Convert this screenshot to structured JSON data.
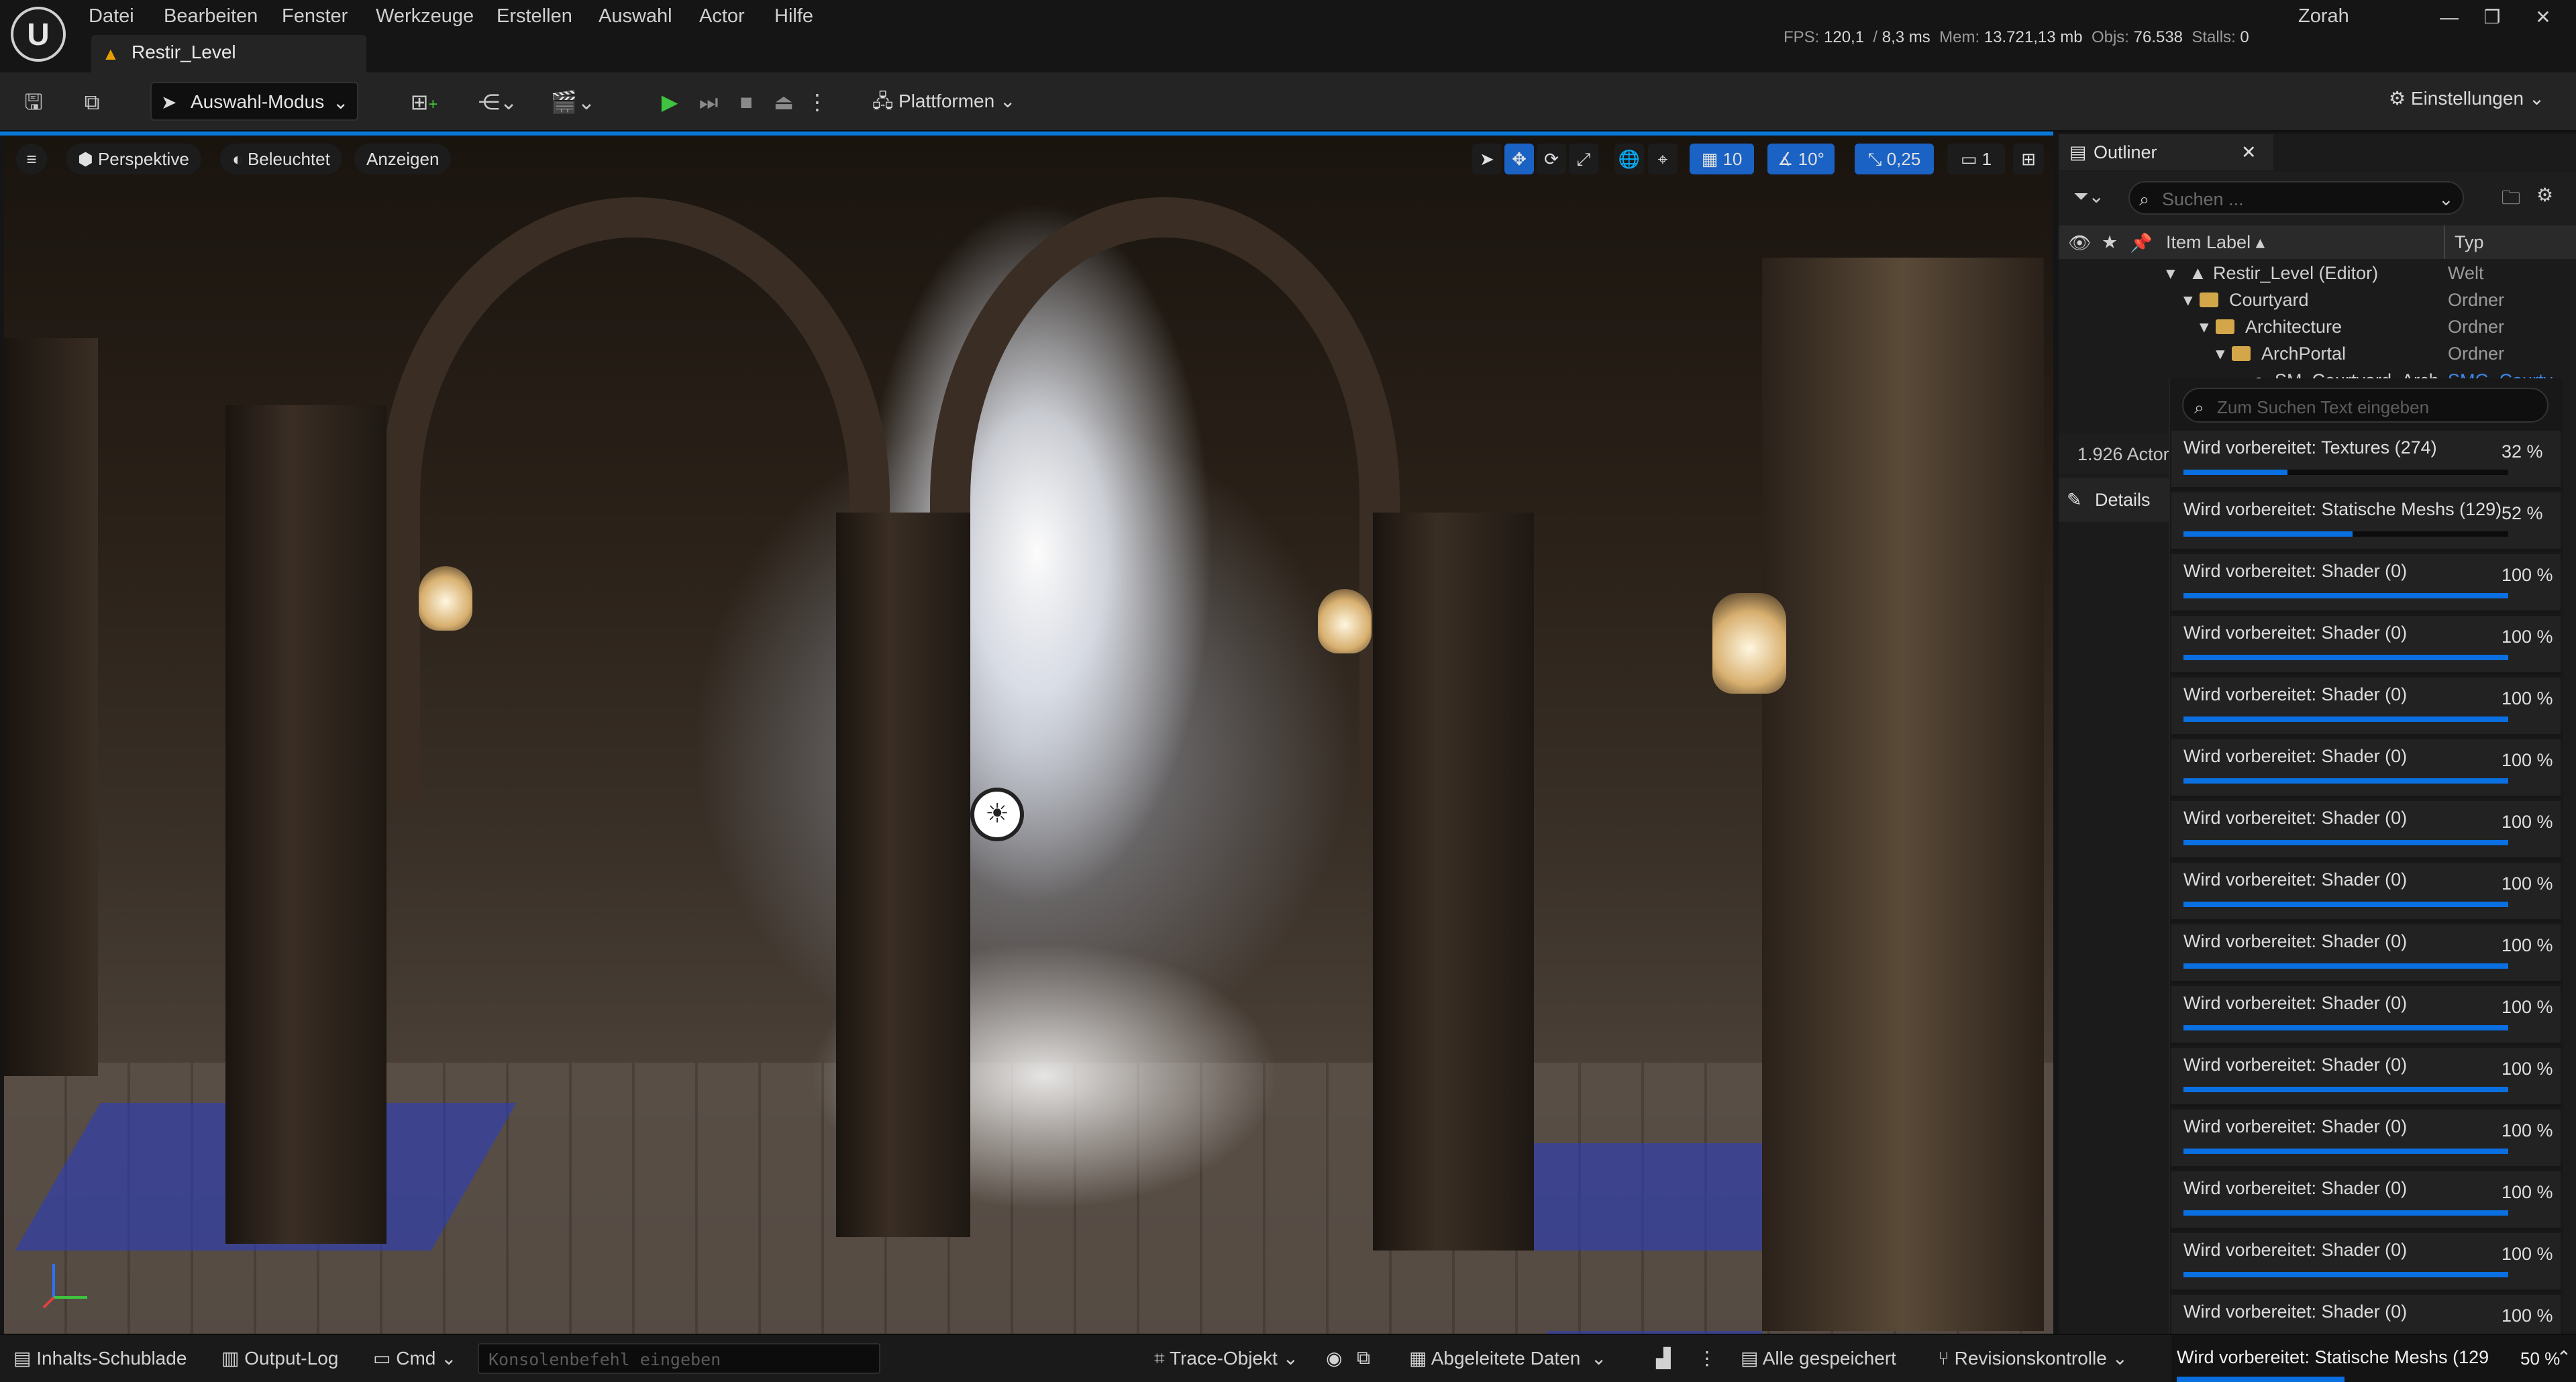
{
  "menu": [
    "Datei",
    "Bearbeiten",
    "Fenster",
    "Werkzeuge",
    "Erstellen",
    "Auswahl",
    "Actor",
    "Hilfe"
  ],
  "level_tab": "Restir_Level",
  "stats": {
    "fps_label": "FPS:",
    "fps": "120,1",
    "ms_label": "/",
    "ms": "8,3 ms",
    "mem_label": "Mem:",
    "mem": "13.721,13 mb",
    "objs_label": "Objs:",
    "objs": "76.538",
    "stalls_label": "Stalls:",
    "stalls": "0"
  },
  "user": "Zorah",
  "toolbar": {
    "mode": "Auswahl-Modus",
    "platforms": "Plattformen",
    "settings": "Einstellungen"
  },
  "viewport": {
    "perspective": "Perspektive",
    "lighting": "Beleuchtet",
    "show": "Anzeigen",
    "grid_snap": "10",
    "rot_snap": "10°",
    "scale_snap": "0,25",
    "camera_speed": "1"
  },
  "outliner": {
    "title": "Outliner",
    "search_placeholder": "Suchen ...",
    "col_label": "Item Label",
    "col_type": "Typ",
    "rows": [
      {
        "label": "Restir_Level (Editor)",
        "type": "Welt"
      },
      {
        "label": "Courtyard",
        "type": "Ordner"
      },
      {
        "label": "Architecture",
        "type": "Ordner"
      },
      {
        "label": "ArchPortal",
        "type": "Ordner"
      },
      {
        "label": "SM_Courtyard_Arch...",
        "type": "SMG_Courty"
      }
    ],
    "actor_count": "1.926 Actor",
    "details": "Details"
  },
  "progress": {
    "search_placeholder": "Zum Suchen Text eingeben",
    "items": [
      {
        "label": "Wird vorbereitet: Textures (274)",
        "pct_text": "32 %",
        "pct": 32
      },
      {
        "label": "Wird vorbereitet: Statische Meshs (129)",
        "pct_text": "52 %",
        "pct": 52
      },
      {
        "label": "Wird vorbereitet: Shader (0)",
        "pct_text": "100 %",
        "pct": 100
      },
      {
        "label": "Wird vorbereitet: Shader (0)",
        "pct_text": "100 %",
        "pct": 100
      },
      {
        "label": "Wird vorbereitet: Shader (0)",
        "pct_text": "100 %",
        "pct": 100
      },
      {
        "label": "Wird vorbereitet: Shader (0)",
        "pct_text": "100 %",
        "pct": 100
      },
      {
        "label": "Wird vorbereitet: Shader (0)",
        "pct_text": "100 %",
        "pct": 100
      },
      {
        "label": "Wird vorbereitet: Shader (0)",
        "pct_text": "100 %",
        "pct": 100
      },
      {
        "label": "Wird vorbereitet: Shader (0)",
        "pct_text": "100 %",
        "pct": 100
      },
      {
        "label": "Wird vorbereitet: Shader (0)",
        "pct_text": "100 %",
        "pct": 100
      },
      {
        "label": "Wird vorbereitet: Shader (0)",
        "pct_text": "100 %",
        "pct": 100
      },
      {
        "label": "Wird vorbereitet: Shader (0)",
        "pct_text": "100 %",
        "pct": 100
      },
      {
        "label": "Wird vorbereitet: Shader (0)",
        "pct_text": "100 %",
        "pct": 100
      },
      {
        "label": "Wird vorbereitet: Shader (0)",
        "pct_text": "100 %",
        "pct": 100
      },
      {
        "label": "Wird vorbereitet: Shader (0)",
        "pct_text": "100 %",
        "pct": 100
      }
    ]
  },
  "statusbar": {
    "content_drawer": "Inhalts-Schublade",
    "output_log": "Output-Log",
    "cmd": "Cmd",
    "console_placeholder": "Konsolenbefehl eingeben",
    "trace": "Trace-Objekt",
    "derived_data": "Abgeleitete Daten",
    "all_saved": "Alle gespeichert",
    "source_control": "Revisionskontrolle",
    "progress_label": "Wird vorbereitet: Statische Meshs (129",
    "progress_pct_text": "50 %",
    "progress_pct": 50
  },
  "colors": {
    "accent": "#0a6fe0",
    "play": "#3ec43e",
    "folder": "#d4a64a"
  }
}
